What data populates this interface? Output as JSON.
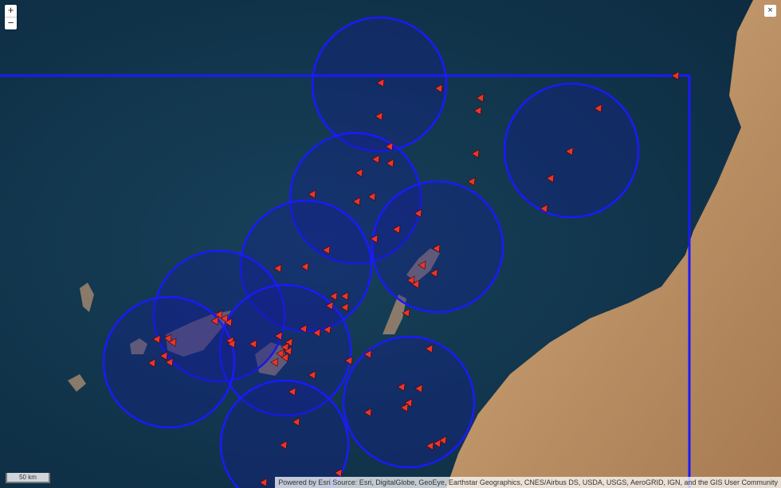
{
  "controls": {
    "zoom_in": "+",
    "zoom_out": "−",
    "close": "×"
  },
  "scale_bar": "50 km",
  "attribution": "Powered by Esri Source: Esri, DigitalGlobe, GeoEye, Earthstar Geographics, CNES/Airbus DS, USDA, USGS, AeroGRID, IGN, and the GIS User Community",
  "colors": {
    "circle": "#1a1aff",
    "marker": "#e8362b",
    "ocean": "#10344b",
    "land": "#c8a27a"
  }
}
